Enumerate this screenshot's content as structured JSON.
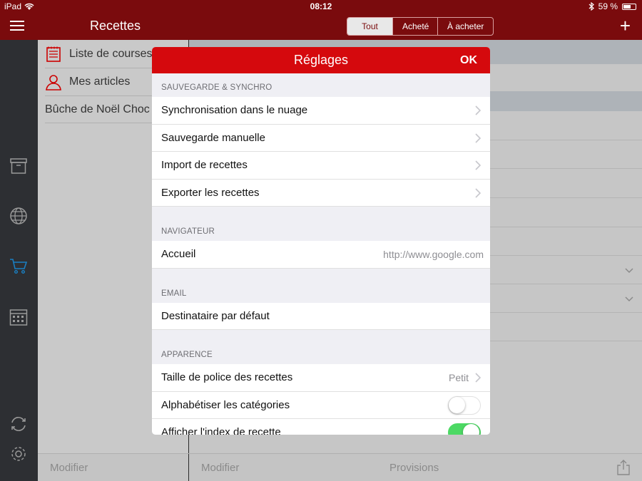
{
  "status": {
    "device": "iPad",
    "time": "08:12",
    "battery": "59 %"
  },
  "nav": {
    "title": "Recettes",
    "segments": [
      "Tout",
      "Acheté",
      "À acheter"
    ],
    "selected_segment": "Tout"
  },
  "left_list": {
    "items": [
      {
        "label": "Liste de courses",
        "icon": "notepad-icon"
      },
      {
        "label": "Mes articles",
        "icon": "person-icon"
      },
      {
        "label": "Bûche de Noël Choc",
        "icon": ""
      }
    ]
  },
  "rail_icons": [
    "box-icon",
    "globe-icon",
    "cart-icon",
    "calendar-icon",
    "sync-icon",
    "gear-icon"
  ],
  "bottom": {
    "left_edit": "Modifier",
    "right_edit": "Modifier",
    "provisions": "Provisions"
  },
  "modal": {
    "title": "Réglages",
    "ok": "OK",
    "sections": {
      "backup": {
        "header": "SAUVEGARDE & SYNCHRO",
        "rows": [
          "Synchronisation dans le nuage",
          "Sauvegarde manuelle",
          "Import de recettes",
          "Exporter les recettes"
        ]
      },
      "browser": {
        "header": "NAVIGATEUR",
        "home_label": "Accueil",
        "home_value": "http://www.google.com"
      },
      "email": {
        "header": "EMAIL",
        "default_recipient_label": "Destinataire par défaut"
      },
      "appearance": {
        "header": "APPARENCE",
        "font_size_label": "Taille de police des recettes",
        "font_size_value": "Petit",
        "alphabetize_label": "Alphabétiser les catégories",
        "alphabetize_on": false,
        "show_index_label": "Afficher l'index de recette",
        "show_index_on": true
      }
    }
  },
  "colors": {
    "header_red": "#d5090d",
    "dark_red": "#7a0b0d",
    "rail": "#2d2f33",
    "toggle_on": "#4cd964",
    "cart_accent": "#1a7fc1"
  }
}
